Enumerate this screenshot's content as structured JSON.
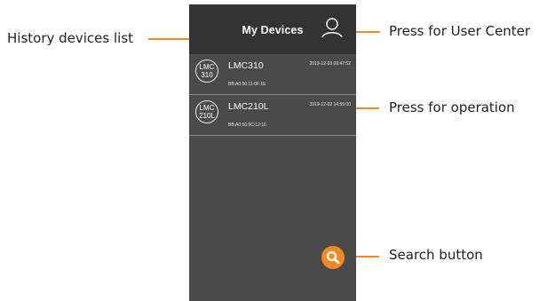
{
  "header": {
    "title": "My Devices",
    "user_icon": "user-icon"
  },
  "devices": [
    {
      "avatar_line1": "LMC",
      "avatar_line2": "310",
      "name": "LMC310",
      "date": "2019-12-03 09:47:52",
      "mac": "BB:A0:50:11:0F:1E"
    },
    {
      "avatar_line1": "LMC",
      "avatar_line2": "210L",
      "name": "LMC210L",
      "date": "2019-12-02 14:55:00",
      "mac": "BB:A0:50:0C:12:16"
    }
  ],
  "search": {
    "icon": "search-icon",
    "color": "#f5891f"
  },
  "callouts": {
    "history": "History devices list",
    "user_center": "Press for User Center",
    "operation": "Press for operation",
    "search": "Search button"
  },
  "colors": {
    "accent": "#f08a24",
    "screen_bg": "#4a4a4a",
    "header_bg": "#333333"
  }
}
